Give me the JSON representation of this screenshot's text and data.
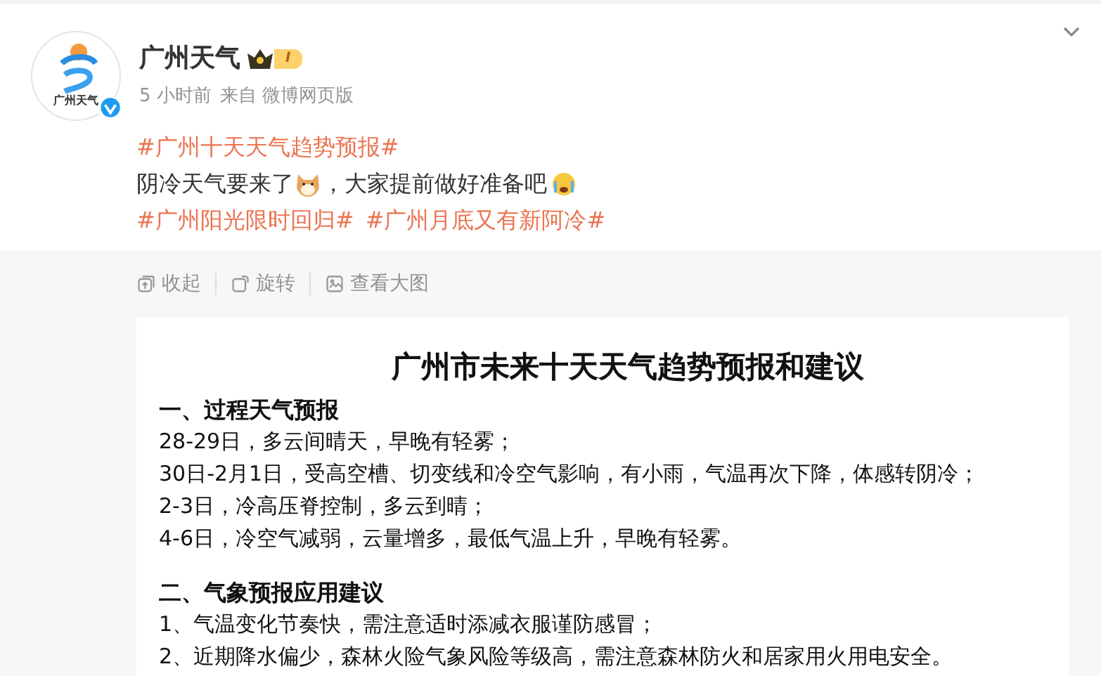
{
  "author": {
    "name": "广州天气",
    "badge": "I",
    "avatar_caption": "广州天气",
    "verified": true
  },
  "meta": {
    "time": "5 小时前",
    "source": "来自 微博网页版"
  },
  "post": {
    "topic": "#广州十天天气趋势预报#",
    "body": [
      "阴冷天气要来了",
      "，大家提前做好准备吧"
    ],
    "tags": [
      "#广州阳光限时回归#",
      "#广州月底又有新阿冷#"
    ]
  },
  "toolbar": [
    "收起",
    "旋转",
    "查看大图"
  ],
  "image": {
    "title": "广州市未来十天天气趋势预报和建议",
    "sections": [
      {
        "heading": "一、过程天气预报",
        "lines": [
          "28-29日，多云间晴天，早晚有轻雾；",
          "30日-2月1日，受高空槽、切变线和冷空气影响，有小雨，气温再次下降，体感转阴冷；",
          "2-3日，冷高压脊控制，多云到晴；",
          "4-6日，冷空气减弱，云量增多，最低气温上升，早晚有轻雾。"
        ]
      },
      {
        "heading": "二、气象预报应用建议",
        "lines": [
          "1、气温变化节奏快，需注意适时添减衣服谨防感冒；",
          "2、近期降水偏少，森林火险气象风险等级高，需注意森林防火和居家用火用电安全。"
        ]
      }
    ]
  }
}
